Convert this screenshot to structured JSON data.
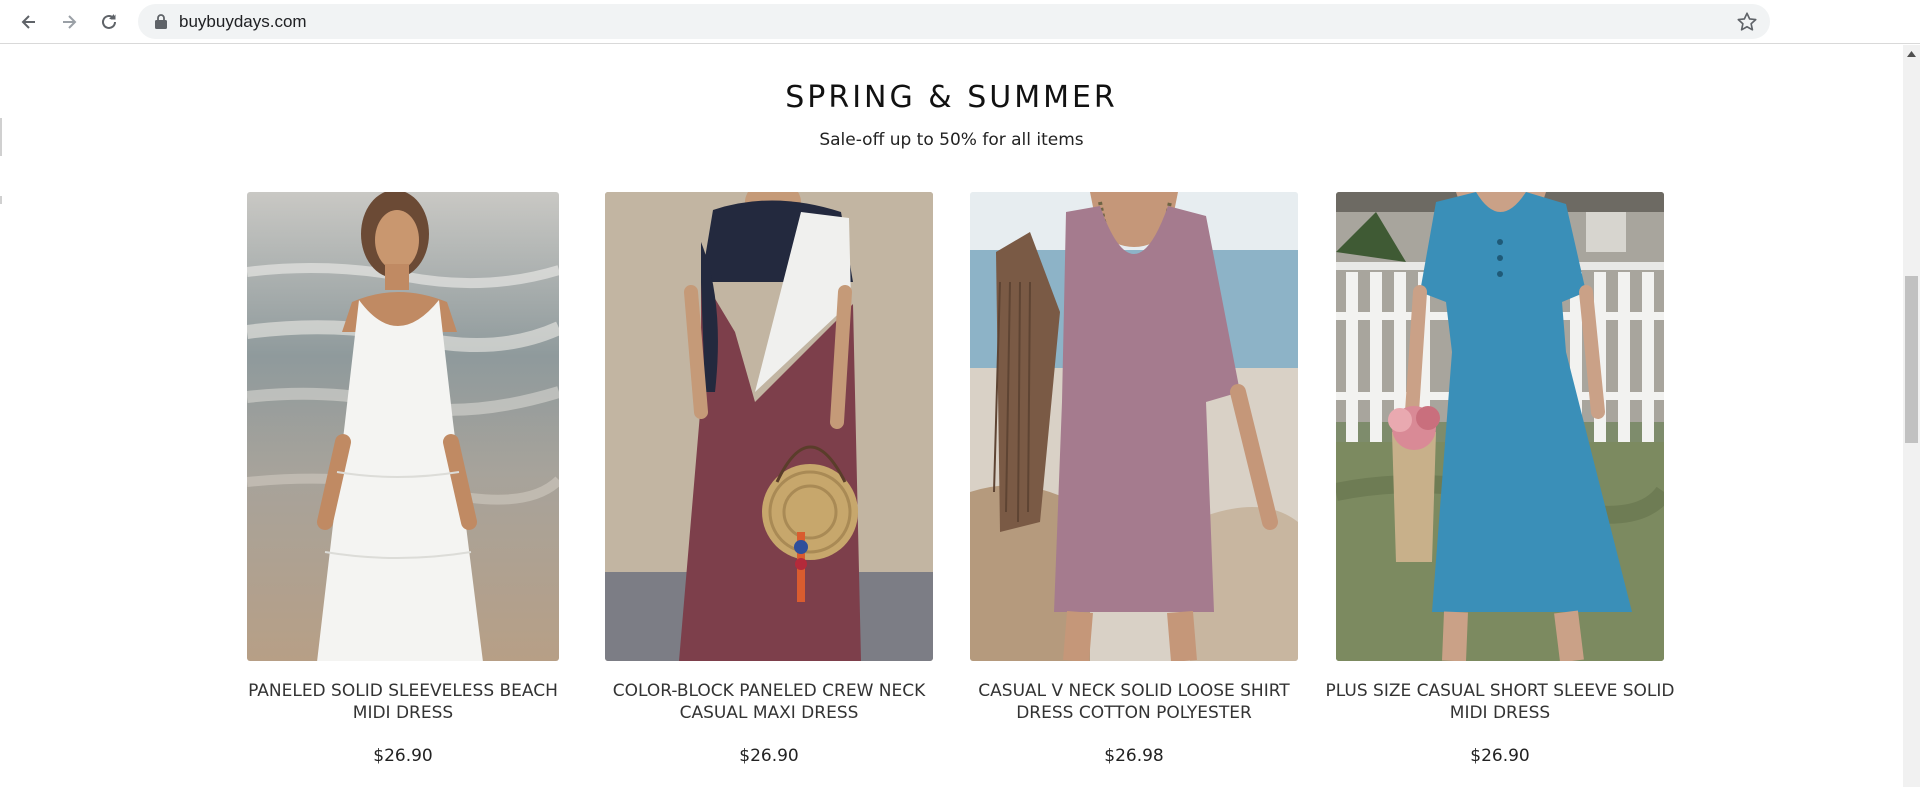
{
  "browser": {
    "url": "buybuydays.com"
  },
  "section": {
    "title": "SPRING & SUMMER",
    "subtitle": "Sale-off up to 50% for all items"
  },
  "products": [
    {
      "title": "PANELED SOLID SLEEVELESS BEACH MIDI DRESS",
      "price": "$26.90",
      "dress_color": "#f4f4f2"
    },
    {
      "title": "COLOR-BLOCK PANELED CREW NECK CASUAL MAXI DRESS",
      "price": "$26.90",
      "dress_color": "#7d3f4b"
    },
    {
      "title": "CASUAL V NECK SOLID LOOSE SHIRT DRESS COTTON POLYESTER",
      "price": "$26.98",
      "dress_color": "#a57b8e"
    },
    {
      "title": "PLUS SIZE CASUAL SHORT SLEEVE SOLID MIDI DRESS",
      "price": "$26.90",
      "dress_color": "#3a8fb8"
    }
  ]
}
